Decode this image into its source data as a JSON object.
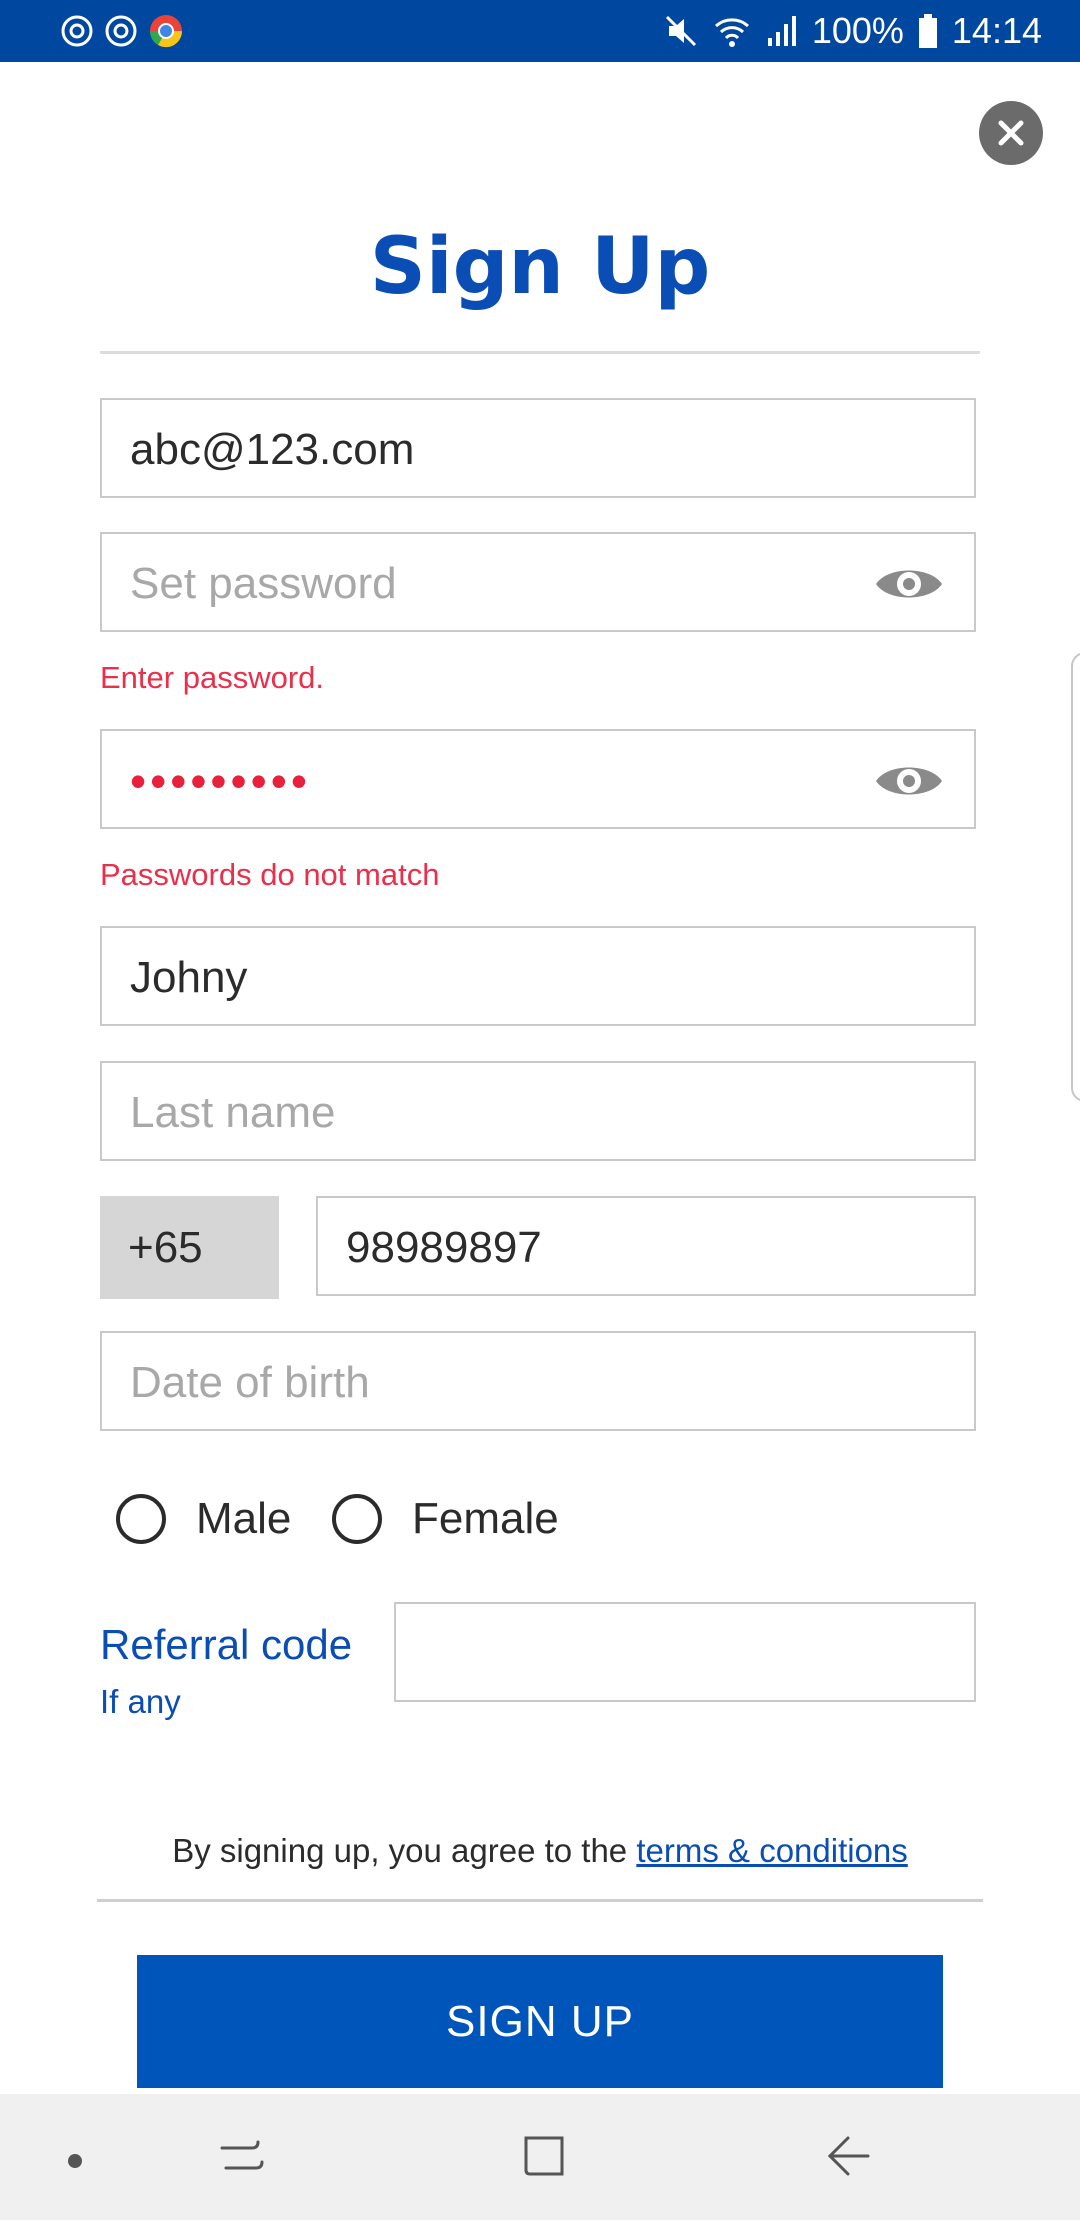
{
  "status_bar": {
    "battery_percent": "100%",
    "time": "14:14",
    "icons": [
      "sync-icon",
      "sync-icon",
      "chrome-icon",
      "mute-icon",
      "wifi-icon",
      "signal-icon",
      "battery-icon"
    ]
  },
  "form": {
    "title": "Sign Up",
    "email": {
      "value": "abc@123.com"
    },
    "password": {
      "placeholder": "Set password",
      "error": "Enter password."
    },
    "confirm_password": {
      "masked_value": "•••••••••",
      "error": "Passwords do not match"
    },
    "first_name": {
      "value": "Johny"
    },
    "last_name": {
      "placeholder": "Last name"
    },
    "phone": {
      "country_code": "+65",
      "number": "98989897"
    },
    "dob": {
      "placeholder": "Date of birth"
    },
    "gender": {
      "options": [
        "Male",
        "Female"
      ]
    },
    "referral": {
      "label": "Referral code",
      "sublabel": "If any",
      "value": ""
    },
    "terms": {
      "text": "By signing up, you agree to the ",
      "link": "terms & conditions"
    },
    "submit_label": "SIGN UP"
  },
  "colors": {
    "brand": "#0055bb",
    "status_bar": "#0047a0",
    "error": "#ea2f4a"
  }
}
